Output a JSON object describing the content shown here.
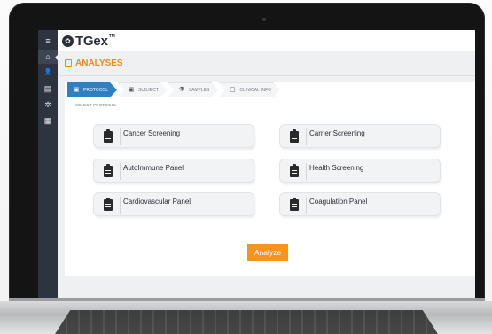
{
  "app": {
    "name": "TGex",
    "trademark": "TM"
  },
  "sidebar": {
    "items": [
      {
        "icon": "menu-icon",
        "glyph": "≡"
      },
      {
        "icon": "home-icon",
        "glyph": "⌂"
      },
      {
        "icon": "user-icon",
        "glyph": "👤"
      },
      {
        "icon": "document-icon",
        "glyph": "▤"
      },
      {
        "icon": "settings-icon",
        "glyph": "✲"
      },
      {
        "icon": "briefcase-icon",
        "glyph": "▦"
      }
    ]
  },
  "section": {
    "title": "ANALYSES"
  },
  "steps": [
    {
      "label": "PROTOCOL",
      "active": true
    },
    {
      "label": "SUBJECT",
      "active": false
    },
    {
      "label": "SAMPLES",
      "active": false
    },
    {
      "label": "CLINICAL INFO",
      "active": false
    }
  ],
  "select_label": "SELECT PROTOCOL",
  "protocols": [
    {
      "label": "Cancer Screening"
    },
    {
      "label": "Carrier Screening"
    },
    {
      "label": "AutoImmune Panel"
    },
    {
      "label": "Health Screening"
    },
    {
      "label": "Cardiovascular Panel"
    },
    {
      "label": "Coagulation Panel"
    }
  ],
  "analyze_button": {
    "label": "Analyze"
  },
  "colors": {
    "accent": "#f7941d",
    "step_active": "#2f7fc1",
    "sidebar": "#2d3440"
  }
}
